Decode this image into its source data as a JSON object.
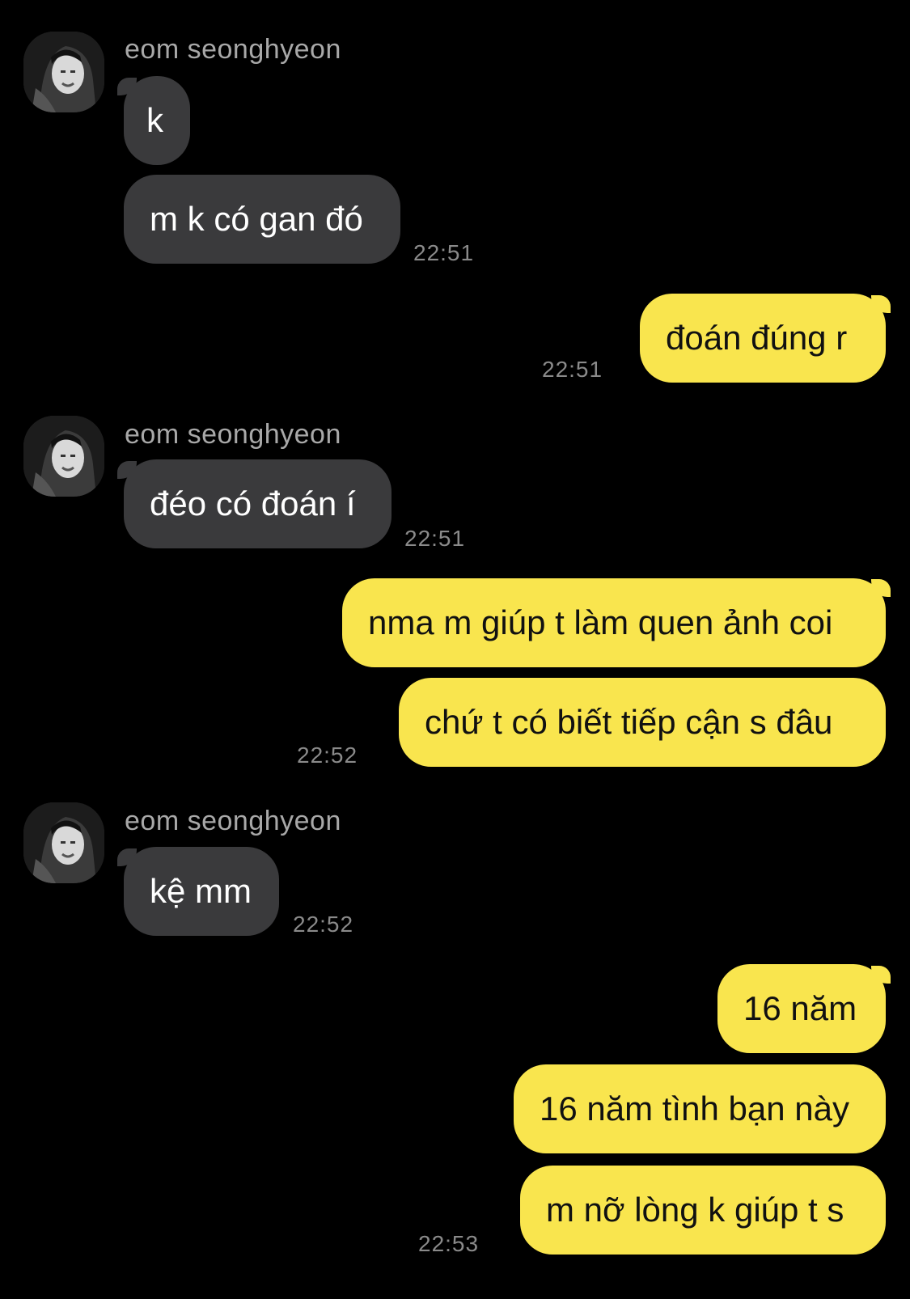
{
  "contact": {
    "name": "eom seonghyeon"
  },
  "messages": [
    {
      "from": "them",
      "text": "k"
    },
    {
      "from": "them",
      "text": "m k có gan đó",
      "time": "22:51"
    },
    {
      "from": "me",
      "text": "đoán đúng r",
      "time": "22:51"
    },
    {
      "from": "them",
      "text": "đéo có đoán í",
      "time": "22:51"
    },
    {
      "from": "me",
      "text": "nma m giúp t làm quen ảnh coi"
    },
    {
      "from": "me",
      "text": "chứ t có biết tiếp cận s đâu",
      "time": "22:52"
    },
    {
      "from": "them",
      "text": "kệ mm",
      "time": "22:52"
    },
    {
      "from": "me",
      "text": "16 năm"
    },
    {
      "from": "me",
      "text": "16 năm tình bạn này"
    },
    {
      "from": "me",
      "text": "m nỡ lòng k giúp t s",
      "time": "22:53"
    }
  ],
  "colors": {
    "background": "#000000",
    "incoming_bubble": "#3a3a3c",
    "outgoing_bubble": "#f9e54e"
  },
  "icons": {
    "avatar": "contact-avatar-photo"
  }
}
